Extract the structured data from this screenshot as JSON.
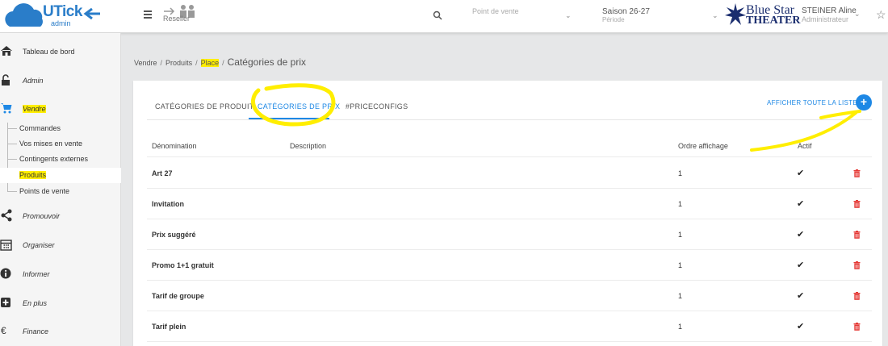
{
  "header": {
    "logo_text": "UTick",
    "logo_sub": "admin",
    "reseller_label": "Reseller",
    "point_de_vente_placeholder": "Point de vente",
    "season_value": "Saison 26-27",
    "season_label": "Période",
    "org_logo_line1": "Blue Star",
    "org_logo_line2": "THEATER",
    "user_name": "STEINER Aline",
    "user_role": "Administrateur"
  },
  "sidebar": {
    "items": [
      {
        "label": "Tableau de bord",
        "icon": "home-icon"
      },
      {
        "label": "Admin",
        "icon": "unlock-icon"
      },
      {
        "label": "Vendre",
        "icon": "cart-icon"
      },
      {
        "label": "Promouvoir",
        "icon": "share-icon"
      },
      {
        "label": "Organiser",
        "icon": "calendar-icon"
      },
      {
        "label": "Informer",
        "icon": "info-icon"
      },
      {
        "label": "En plus",
        "icon": "plus-square-icon"
      },
      {
        "label": "Finance",
        "icon": "euro-icon"
      }
    ],
    "vendre_sub": [
      {
        "label": "Commandes"
      },
      {
        "label": "Vos mises en vente"
      },
      {
        "label": "Contingents externes"
      },
      {
        "label": "Produits"
      },
      {
        "label": "Points de vente"
      }
    ]
  },
  "breadcrumb": {
    "items": [
      "Vendre",
      "Produits",
      "Place"
    ],
    "sep": "/",
    "current": "Catégories de prix"
  },
  "tabs": [
    {
      "label": "CATÉGORIES DE PRODUIT"
    },
    {
      "label": "CATÉGORIES DE PRIX"
    },
    {
      "label": "#PRICECONFIGS"
    }
  ],
  "actions": {
    "show_all": "AFFICHER TOUTE LA LISTE",
    "add": "+"
  },
  "table": {
    "columns": [
      "Dénomination",
      "Description",
      "Ordre affichage",
      "Actif"
    ],
    "rows": [
      {
        "name": "Art 27",
        "description": "",
        "order": "1",
        "active": "✔"
      },
      {
        "name": "Invitation",
        "description": "",
        "order": "1",
        "active": "✔"
      },
      {
        "name": "Prix suggéré",
        "description": "",
        "order": "1",
        "active": "✔"
      },
      {
        "name": "Promo 1+1 gratuit",
        "description": "",
        "order": "1",
        "active": "✔"
      },
      {
        "name": "Tarif de groupe",
        "description": "",
        "order": "1",
        "active": "✔"
      },
      {
        "name": "Tarif plein",
        "description": "",
        "order": "1",
        "active": "✔"
      }
    ]
  },
  "colors": {
    "accent": "#1e88e5",
    "delete": "#e53935",
    "highlight": "#ffee00"
  }
}
